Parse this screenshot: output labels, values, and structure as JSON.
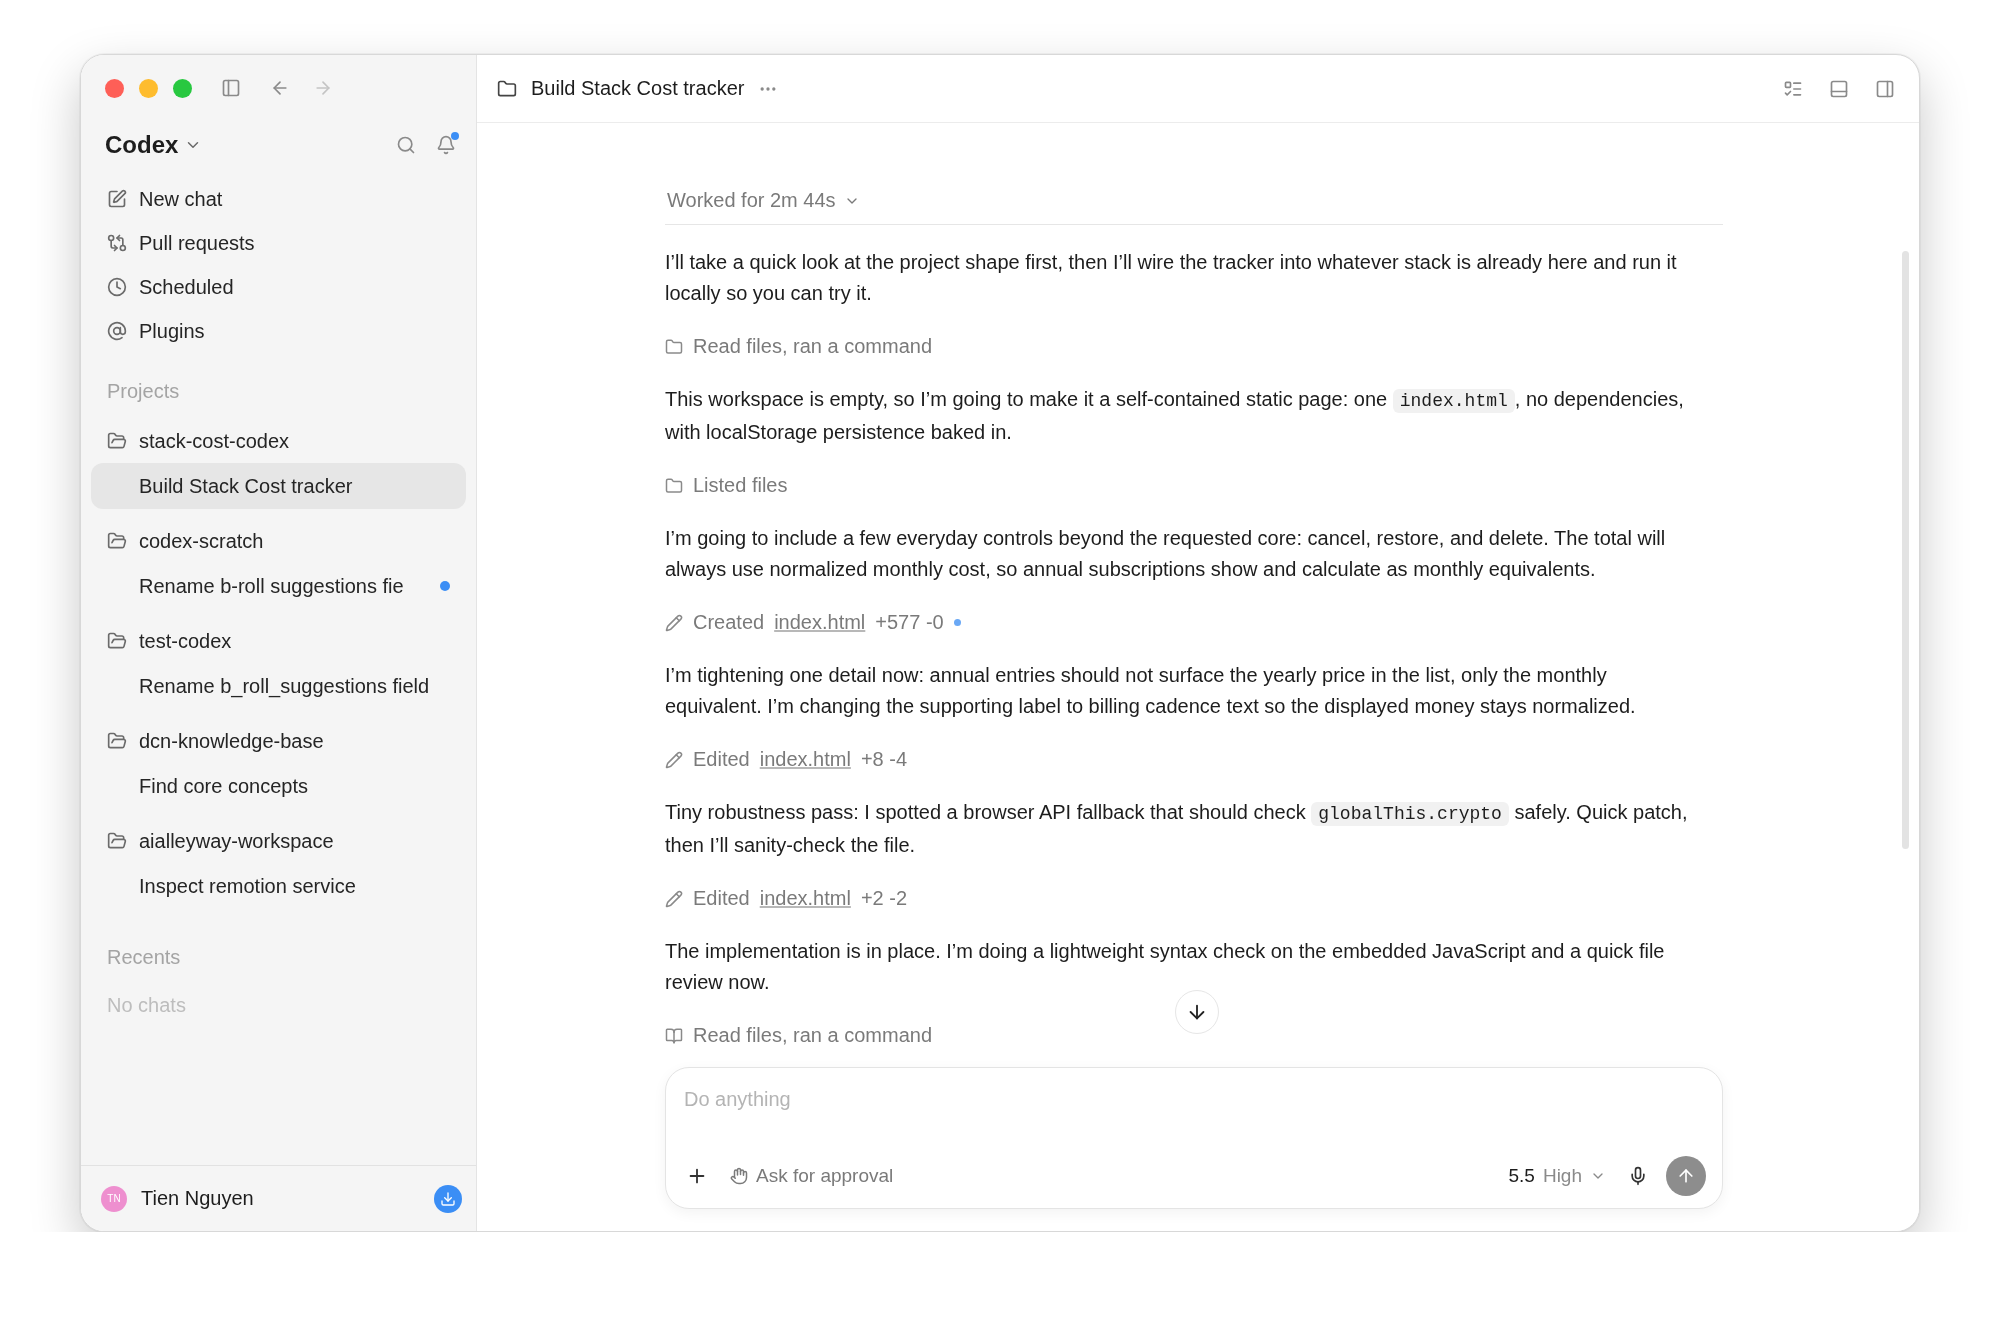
{
  "sidebar": {
    "app_name": "Codex",
    "notifications_unread": true,
    "nav": [
      {
        "label": "New chat"
      },
      {
        "label": "Pull requests"
      },
      {
        "label": "Scheduled"
      },
      {
        "label": "Plugins"
      }
    ],
    "projects_label": "Projects",
    "projects": [
      {
        "name": "stack-cost-codex",
        "chats": [
          {
            "title": "Build Stack Cost tracker",
            "selected": true,
            "unread": false
          }
        ]
      },
      {
        "name": "codex-scratch",
        "chats": [
          {
            "title": "Rename b-roll suggestions fie",
            "selected": false,
            "unread": true
          }
        ]
      },
      {
        "name": "test-codex",
        "chats": [
          {
            "title": "Rename b_roll_suggestions field",
            "selected": false,
            "unread": false
          }
        ]
      },
      {
        "name": "dcn-knowledge-base",
        "chats": [
          {
            "title": "Find core concepts",
            "selected": false,
            "unread": false
          }
        ]
      },
      {
        "name": "aialleyway-workspace",
        "chats": [
          {
            "title": "Inspect remotion service",
            "selected": false,
            "unread": false
          }
        ]
      }
    ],
    "recents_label": "Recents",
    "recents_empty": "No chats",
    "user": {
      "initials": "TN",
      "name": "Tien Nguyen",
      "update_available": true
    }
  },
  "header": {
    "title": "Build Stack Cost tracker"
  },
  "chat": {
    "worked": "Worked for 2m 44s",
    "messages": [
      {
        "kind": "text",
        "parts": [
          {
            "kind": "plain",
            "text": "I’ll take a quick look at the project shape first, then I’ll wire the tracker into whatever stack is already here and run it locally so you can try it."
          }
        ]
      },
      {
        "kind": "browse",
        "label": "Read files, ran a command"
      },
      {
        "kind": "text",
        "parts": [
          {
            "kind": "plain",
            "text": "This workspace is empty, so I’m going to make it a self-contained static page: one "
          },
          {
            "kind": "code",
            "text": "index.html"
          },
          {
            "kind": "plain",
            "text": ", no dependencies, with localStorage persistence baked in."
          }
        ]
      },
      {
        "kind": "browse",
        "label": "Listed files"
      },
      {
        "kind": "text",
        "parts": [
          {
            "kind": "plain",
            "text": "I’m going to include a few everyday controls beyond the requested core: cancel, restore, and delete. The total will always use normalized monthly cost, so annual subscriptions show and calculate as monthly equivalents."
          }
        ]
      },
      {
        "kind": "edit",
        "label": "Created",
        "file": "index.html",
        "diff": "+577 -0",
        "unread": true
      },
      {
        "kind": "text",
        "parts": [
          {
            "kind": "plain",
            "text": "I’m tightening one detail now: annual entries should not surface the yearly price in the list, only the monthly equivalent. I’m changing the supporting label to billing cadence text so the displayed money stays normalized."
          }
        ]
      },
      {
        "kind": "edit",
        "label": "Edited",
        "file": "index.html",
        "diff": "+8 -4",
        "unread": false
      },
      {
        "kind": "text",
        "parts": [
          {
            "kind": "plain",
            "text": "Tiny robustness pass: I spotted a browser API fallback that should check "
          },
          {
            "kind": "code",
            "text": "globalThis.crypto"
          },
          {
            "kind": "plain",
            "text": " safely. Quick patch, then I’ll sanity-check the file."
          }
        ]
      },
      {
        "kind": "edit",
        "label": "Edited",
        "file": "index.html",
        "diff": "+2 -2",
        "unread": false
      },
      {
        "kind": "text",
        "parts": [
          {
            "kind": "plain",
            "text": "The implementation is in place. I’m doing a lightweight syntax check on the embedded JavaScript and a quick file review now."
          }
        ]
      },
      {
        "kind": "read",
        "label": "Read files, ran a command"
      }
    ]
  },
  "composer": {
    "placeholder": "Do anything",
    "approval": "Ask for approval",
    "model": "5.5",
    "effort": "High"
  }
}
